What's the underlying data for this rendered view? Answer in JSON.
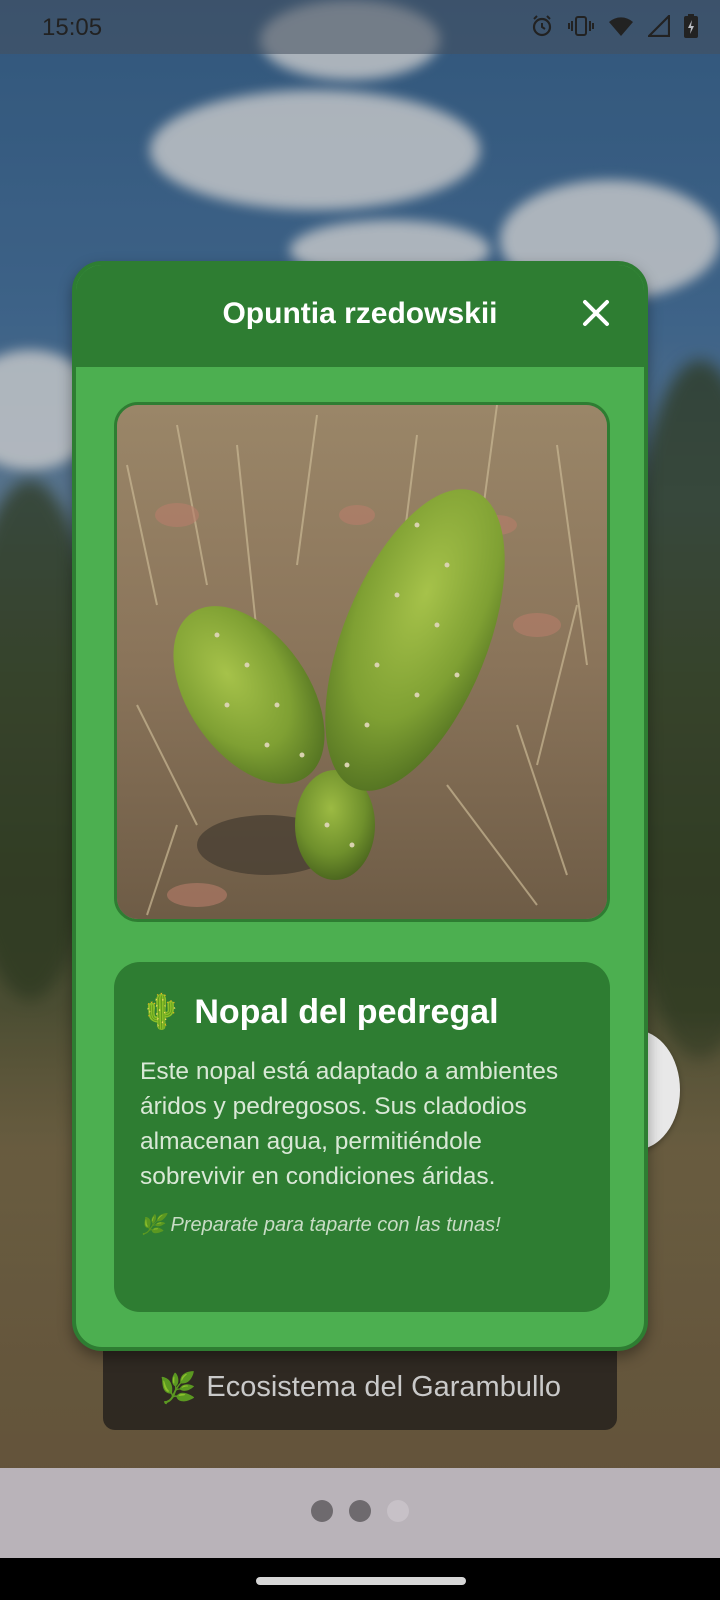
{
  "status_bar": {
    "time": "15:05",
    "icons": [
      "alarm-icon",
      "vibrate-icon",
      "wifi-icon",
      "signal-icon",
      "battery-icon"
    ]
  },
  "dialog": {
    "title": "Opuntia rzedowskii",
    "close_icon": "close-icon",
    "photo_alt": "Opuntia rzedowskii",
    "card": {
      "emoji": "🌵",
      "heading": "Nopal del pedregal",
      "description": "Este nopal está adaptado a ambientes áridos y pedregosos. Sus cladodios almacenan agua, permitiéndole sobrevivir en condiciones áridas.",
      "note_emoji": "🌿",
      "note": "Preparate para taparte con las tunas!"
    }
  },
  "banner": {
    "emoji": "🌿",
    "label": "Ecosistema del Garambullo"
  },
  "pager": {
    "total": 3,
    "active_index": 1
  },
  "colors": {
    "dialog_header": "#2e7d32",
    "dialog_body": "#4caf50",
    "card_bg": "#2e7d32"
  }
}
